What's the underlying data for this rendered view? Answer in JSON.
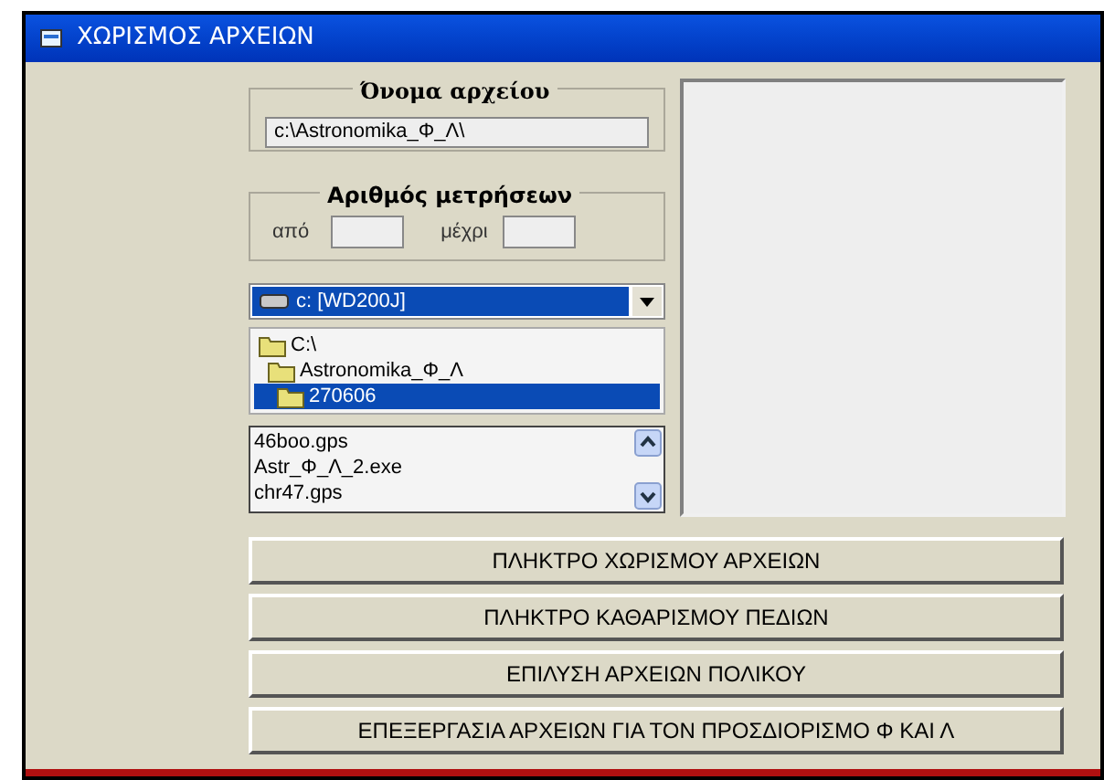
{
  "window": {
    "title": "ΧΩΡΙΣΜΟΣ ΑΡΧΕΙΩΝ"
  },
  "file_name": {
    "label": "Όνομα αρχείου",
    "value": "c:\\Astronomika_Φ_Λ\\"
  },
  "measurements": {
    "label": "Αριθμός μετρήσεων",
    "from_label": "από",
    "to_label": "μέχρι"
  },
  "drive": {
    "value": "c: [WD200J]"
  },
  "directories": [
    {
      "name": "C:\\",
      "selected": false,
      "children": [
        {
          "name": "Astronomika_Φ_Λ",
          "selected": false,
          "children": [
            {
              "name": "270606",
              "selected": true
            }
          ]
        }
      ]
    }
  ],
  "files": [
    "46boo.gps",
    "Astr_Φ_Λ_2.exe",
    "chr47.gps"
  ],
  "buttons": [
    "ΠΛΗΚΤΡΟ ΧΩΡΙΣΜΟΥ ΑΡΧΕΙΩΝ",
    "ΠΛΗΚΤΡΟ ΚΑΘΑΡΙΣΜΟΥ ΠΕΔΙΩΝ",
    "ΕΠΙΛΥΣΗ ΑΡΧΕΙΩΝ ΠΟΛΙΚΟΥ",
    "ΕΠΕΞΕΡΓΑΣΙΑ ΑΡΧΕΙΩΝ ΓΙΑ ΤΟΝ ΠΡΟΣΔΙΟΡΙΣΜΟ Φ ΚΑΙ Λ"
  ]
}
